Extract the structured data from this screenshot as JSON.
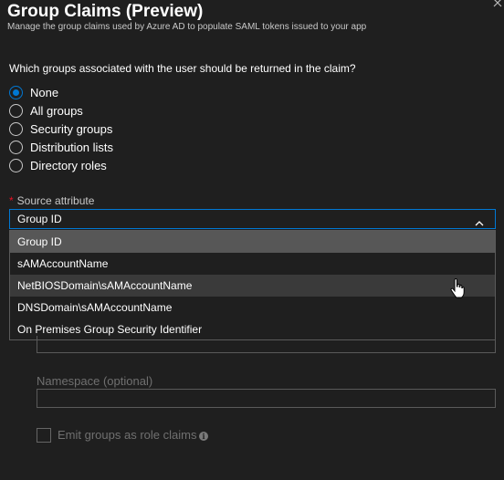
{
  "header": {
    "title": "Group Claims (Preview)",
    "subtitle": "Manage the group claims used by Azure AD to populate SAML tokens issued to your app"
  },
  "question": "Which groups associated with the user should be returned in the claim?",
  "group_options": [
    {
      "label": "None",
      "checked": true
    },
    {
      "label": "All groups",
      "checked": false
    },
    {
      "label": "Security groups",
      "checked": false
    },
    {
      "label": "Distribution lists",
      "checked": false
    },
    {
      "label": "Directory roles",
      "checked": false
    }
  ],
  "source_attribute": {
    "required_marker": "*",
    "label": "Source attribute",
    "value": "Group ID",
    "chevron_icon": "chevron-up-icon",
    "options": [
      "Group ID",
      "sAMAccountName",
      "NetBIOSDomain\\sAMAccountName",
      "DNSDomain\\sAMAccountName",
      "On Premises Group Security Identifier"
    ],
    "selected_option": "Group ID",
    "hovered_option": "NetBIOSDomain\\sAMAccountName"
  },
  "namespace": {
    "label": "Namespace (optional)",
    "value": ""
  },
  "emit_roles": {
    "label": "Emit groups as role claims",
    "checked": false,
    "info_icon": "info-icon",
    "info_glyph": "i"
  },
  "colors": {
    "background": "#1f1f1f",
    "accent": "#0078d4",
    "required": "#e81123",
    "selected_option": "#575757",
    "disabled_text": "#707070"
  }
}
